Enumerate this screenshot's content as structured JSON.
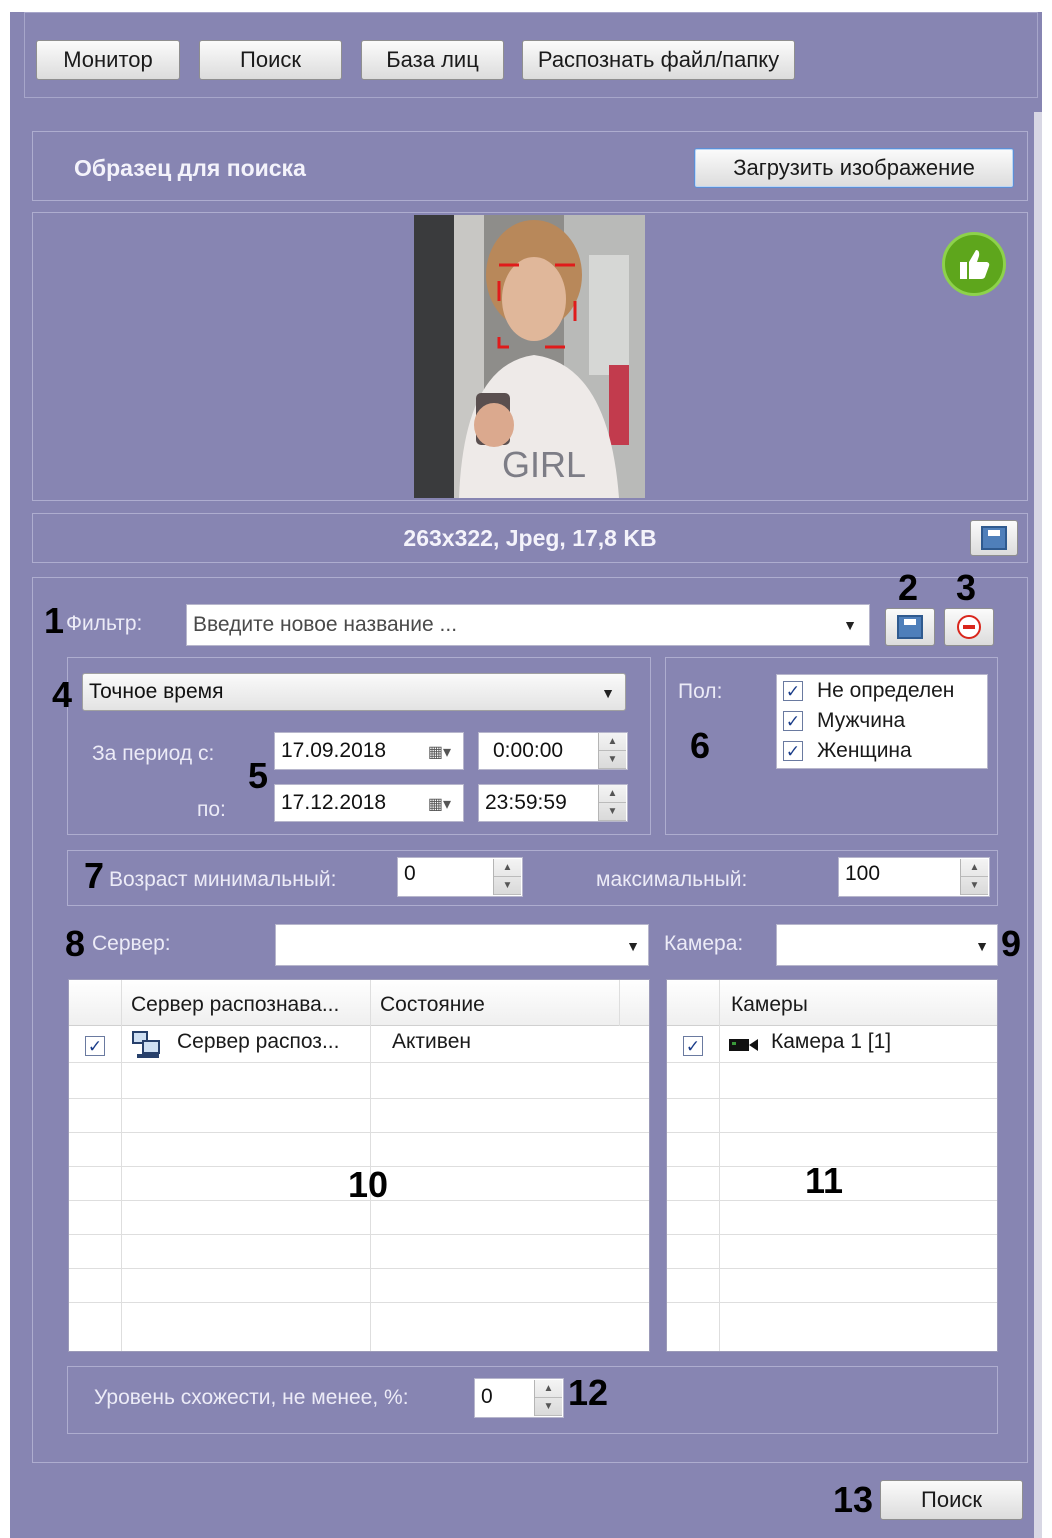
{
  "toolbar": {
    "monitor": "Монитор",
    "search": "Поиск",
    "faces_db": "База лиц",
    "recognize": "Распознать файл/папку"
  },
  "sample": {
    "title": "Образец для поиска",
    "load_button": "Загрузить изображение",
    "image_text": "GIRL",
    "info": "263x322, Jpeg, 17,8 KB"
  },
  "filter": {
    "label": "Фильтр:",
    "placeholder": "Введите новое название ..."
  },
  "time": {
    "mode": "Точное время",
    "from_label": "За период с:",
    "to_label": "по:",
    "from_date": "17.09.2018",
    "from_time": "0:00:00",
    "to_date": "17.12.2018",
    "to_time": "23:59:59"
  },
  "gender": {
    "label": "Пол:",
    "options": [
      "Не определен",
      "Мужчина",
      "Женщина"
    ]
  },
  "age": {
    "min_label": "Возраст минимальный:",
    "min_value": "0",
    "max_label": "максимальный:",
    "max_value": "100"
  },
  "server": {
    "label": "Сервер:"
  },
  "camera": {
    "label": "Камера:"
  },
  "servers_table": {
    "columns": [
      "Сервер распознава...",
      "Состояние"
    ],
    "rows": [
      {
        "name": "Сервер распоз...",
        "state": "Активен"
      }
    ]
  },
  "cameras_table": {
    "columns": [
      "Камеры"
    ],
    "rows": [
      {
        "name": "Камера 1 [1]"
      }
    ]
  },
  "similarity": {
    "label": "Уровень схожести, не менее, %:",
    "value": "0"
  },
  "search_button": "Поиск",
  "callouts": [
    "1",
    "2",
    "3",
    "4",
    "5",
    "6",
    "7",
    "8",
    "9",
    "10",
    "11",
    "12",
    "13"
  ],
  "colors": {
    "panel": "#8785b2",
    "accent_green": "#5ea61c",
    "remove_red": "#d9261c"
  }
}
